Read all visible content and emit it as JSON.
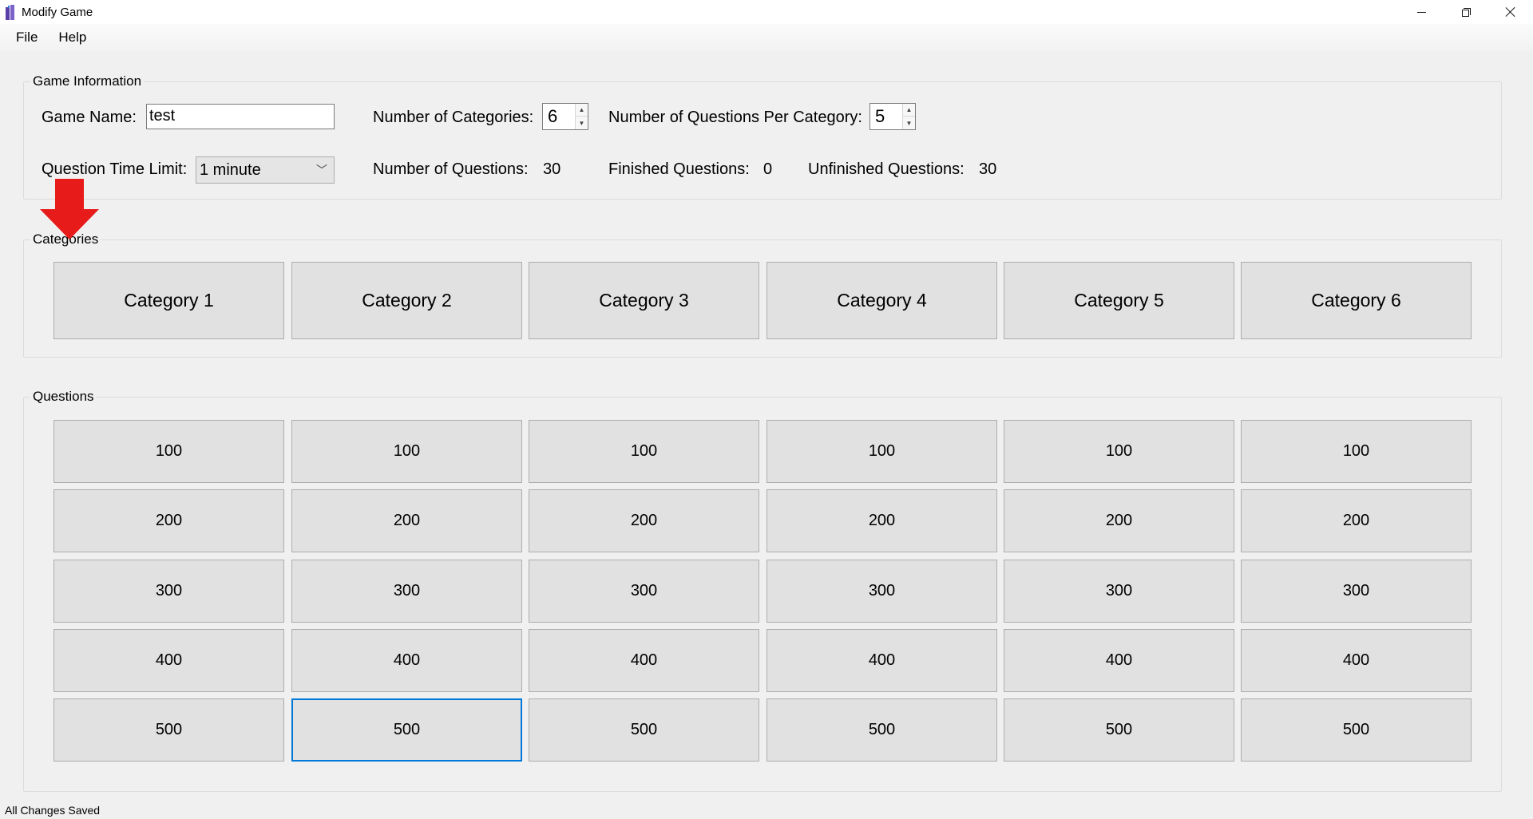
{
  "window": {
    "title": "Modify Game",
    "icon": "app-icon",
    "controls": [
      "minimize-icon",
      "restore-icon",
      "close-icon"
    ]
  },
  "menu": {
    "file": "File",
    "help": "Help"
  },
  "game_info": {
    "legend": "Game Information",
    "game_name_label": "Game Name:",
    "game_name_value": "test",
    "num_categories_label": "Number of Categories:",
    "num_categories_value": "6",
    "num_questions_per_category_label": "Number of Questions Per Category:",
    "num_questions_per_category_value": "5",
    "time_limit_label": "Question Time Limit:",
    "time_limit_value": "1 minute",
    "num_questions_label": "Number of Questions:",
    "num_questions_value": "30",
    "finished_label": "Finished Questions:",
    "finished_value": "0",
    "unfinished_label": "Unfinished Questions:",
    "unfinished_value": "30"
  },
  "categories": {
    "legend": "Categories",
    "items": [
      "Category 1",
      "Category 2",
      "Category 3",
      "Category 4",
      "Category 5",
      "Category 6"
    ]
  },
  "questions": {
    "legend": "Questions",
    "values": [
      "100",
      "200",
      "300",
      "400",
      "500"
    ],
    "focused": {
      "row": 4,
      "col": 1
    }
  },
  "annotation": {
    "icon": "red-arrow-down-icon",
    "color": "#e81b1b"
  },
  "status": {
    "text": "All Changes Saved"
  }
}
